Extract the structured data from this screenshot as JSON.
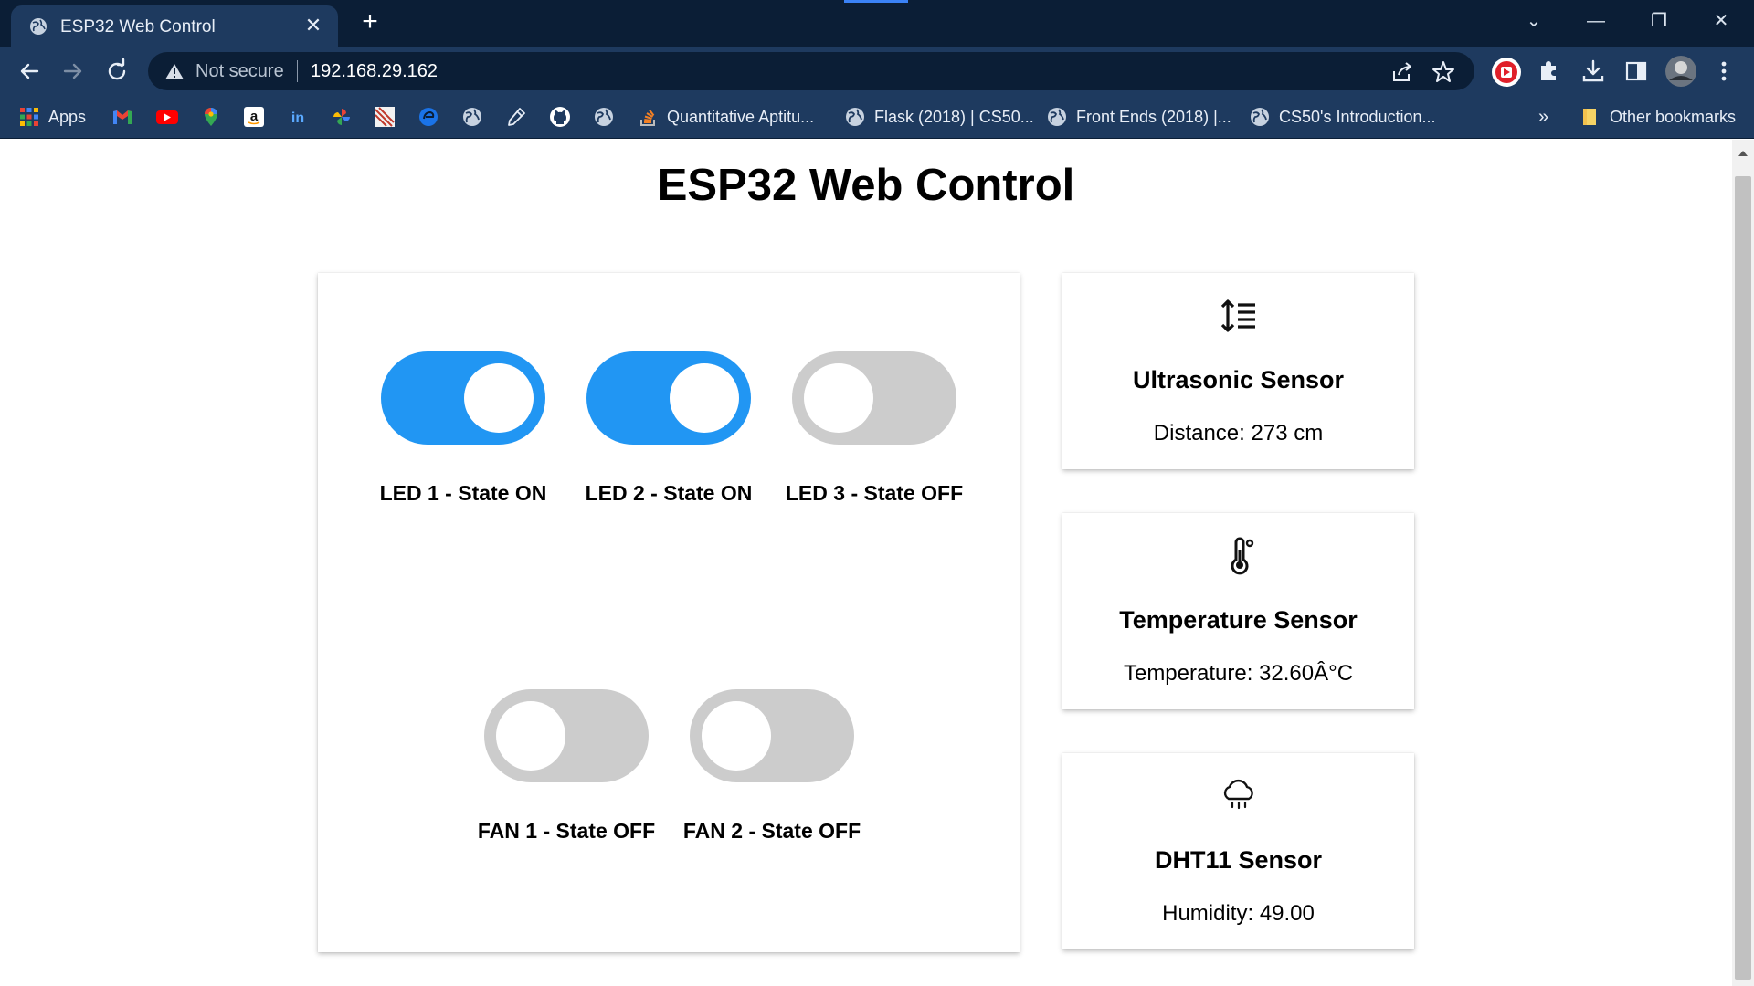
{
  "browser": {
    "tab_title": "ESP32 Web Control",
    "tab_close": "✕",
    "new_tab": "+",
    "address": {
      "security_label": "Not secure",
      "url": "192.168.29.162"
    },
    "bookmarks": {
      "apps_label": "Apps",
      "items": [
        "Quantitative Aptitu...",
        "Flask (2018) | CS50...",
        "Front Ends (2018) |...",
        "CS50's Introduction..."
      ],
      "overflow": "»",
      "other_label": "Other bookmarks"
    },
    "window_controls": {
      "menu": "⌄",
      "minimize": "—",
      "restore": "❐",
      "close": "✕"
    }
  },
  "page": {
    "title": "ESP32 Web Control",
    "switches": [
      {
        "label": "LED 1 - State ON",
        "on": true
      },
      {
        "label": "LED 2 - State ON",
        "on": true
      },
      {
        "label": "LED 3 - State OFF",
        "on": false
      },
      {
        "label": "FAN 1 - State OFF",
        "on": false
      },
      {
        "label": "FAN 2 - State OFF",
        "on": false
      }
    ],
    "sensors": [
      {
        "icon": "line-spacing-icon",
        "title": "Ultrasonic Sensor",
        "value": "Distance: 273 cm"
      },
      {
        "icon": "thermometer-icon",
        "title": "Temperature Sensor",
        "value": "Temperature: 32.60Â°C"
      },
      {
        "icon": "cloud-rain-icon",
        "title": "DHT11 Sensor",
        "value": "Humidity: 49.00"
      }
    ]
  },
  "colors": {
    "switch_on": "#2196f3",
    "switch_off": "#cccccc",
    "chrome_dark": "#0b1e36",
    "chrome_mid": "#1e3a5f"
  }
}
